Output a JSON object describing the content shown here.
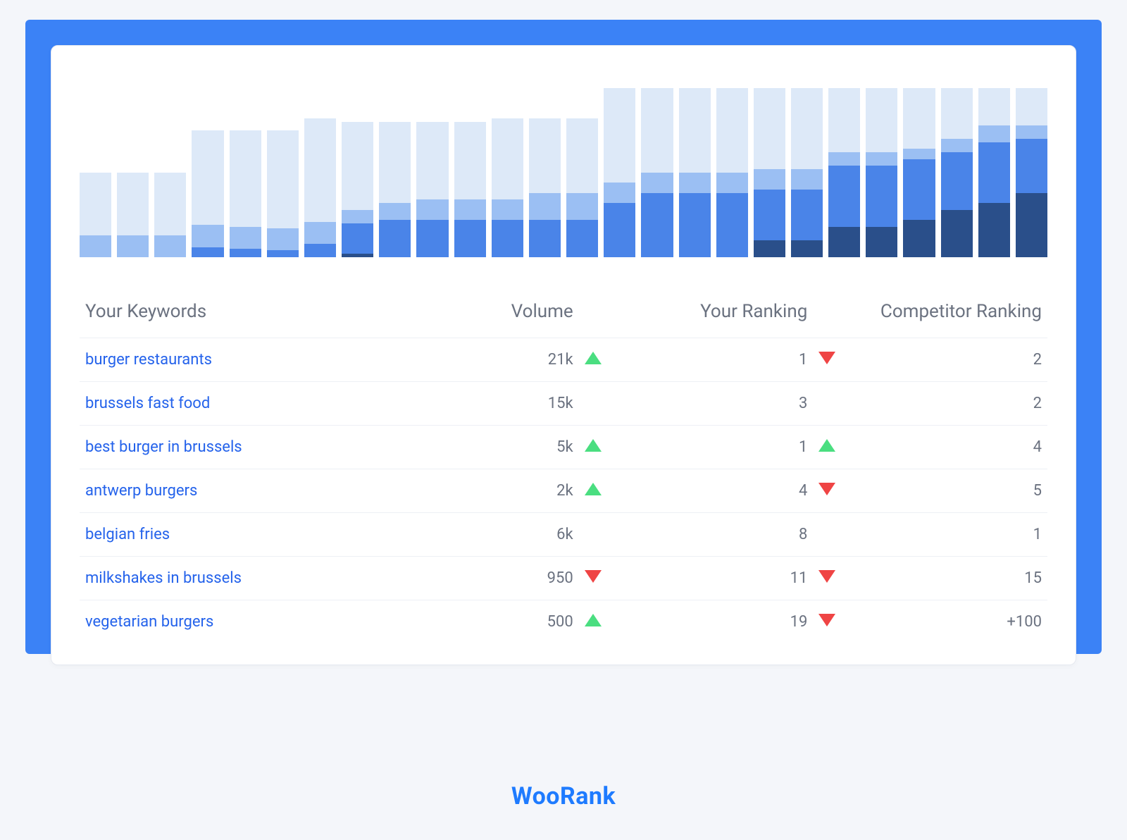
{
  "brand": "WooRank",
  "colors": {
    "frame": "#3b82f6",
    "link": "#2563eb",
    "up": "#4ade80",
    "down": "#ef4444",
    "seg_a": "#dde9f8",
    "seg_b": "#9bbff3",
    "seg_c": "#4a84e8",
    "seg_d": "#2a4f8a"
  },
  "chart_data": {
    "type": "bar",
    "stacked": true,
    "note": "Values are relative stacked segment heights (0-100) estimated visually; no numeric axis is shown.",
    "segment_order_bottom_to_top": [
      "d",
      "c",
      "b",
      "a"
    ],
    "bars": [
      {
        "d": 0,
        "c": 0,
        "b": 13,
        "a": 50
      },
      {
        "d": 0,
        "c": 0,
        "b": 13,
        "a": 50
      },
      {
        "d": 0,
        "c": 0,
        "b": 13,
        "a": 50
      },
      {
        "d": 0,
        "c": 6,
        "b": 13,
        "a": 75
      },
      {
        "d": 0,
        "c": 5,
        "b": 13,
        "a": 75
      },
      {
        "d": 0,
        "c": 4,
        "b": 13,
        "a": 75
      },
      {
        "d": 0,
        "c": 8,
        "b": 13,
        "a": 82
      },
      {
        "d": 2,
        "c": 18,
        "b": 8,
        "a": 80
      },
      {
        "d": 0,
        "c": 22,
        "b": 10,
        "a": 80
      },
      {
        "d": 0,
        "c": 22,
        "b": 12,
        "a": 80
      },
      {
        "d": 0,
        "c": 22,
        "b": 12,
        "a": 80
      },
      {
        "d": 0,
        "c": 22,
        "b": 12,
        "a": 82
      },
      {
        "d": 0,
        "c": 22,
        "b": 16,
        "a": 82
      },
      {
        "d": 0,
        "c": 22,
        "b": 16,
        "a": 82
      },
      {
        "d": 0,
        "c": 32,
        "b": 12,
        "a": 100
      },
      {
        "d": 0,
        "c": 38,
        "b": 12,
        "a": 100
      },
      {
        "d": 0,
        "c": 38,
        "b": 12,
        "a": 100
      },
      {
        "d": 0,
        "c": 38,
        "b": 12,
        "a": 100
      },
      {
        "d": 10,
        "c": 30,
        "b": 12,
        "a": 100
      },
      {
        "d": 10,
        "c": 30,
        "b": 12,
        "a": 100
      },
      {
        "d": 18,
        "c": 36,
        "b": 8,
        "a": 100
      },
      {
        "d": 18,
        "c": 36,
        "b": 8,
        "a": 100
      },
      {
        "d": 22,
        "c": 36,
        "b": 6,
        "a": 100
      },
      {
        "d": 28,
        "c": 34,
        "b": 8,
        "a": 100
      },
      {
        "d": 32,
        "c": 36,
        "b": 10,
        "a": 100
      },
      {
        "d": 38,
        "c": 32,
        "b": 8,
        "a": 100
      }
    ]
  },
  "table": {
    "headers": {
      "keywords": "Your Keywords",
      "volume": "Volume",
      "your_ranking": "Your Ranking",
      "competitor_ranking": "Competitor Ranking"
    },
    "rows": [
      {
        "keyword": "burger restaurants",
        "volume": "21k",
        "your_trend": "up",
        "your_rank": "1",
        "comp_trend": "down",
        "comp_rank": "2"
      },
      {
        "keyword": "brussels fast food",
        "volume": "15k",
        "your_trend": "",
        "your_rank": "3",
        "comp_trend": "",
        "comp_rank": "2"
      },
      {
        "keyword": "best burger in brussels",
        "volume": "5k",
        "your_trend": "up",
        "your_rank": "1",
        "comp_trend": "up",
        "comp_rank": "4"
      },
      {
        "keyword": "antwerp burgers",
        "volume": "2k",
        "your_trend": "up",
        "your_rank": "4",
        "comp_trend": "down",
        "comp_rank": "5"
      },
      {
        "keyword": "belgian fries",
        "volume": "6k",
        "your_trend": "",
        "your_rank": "8",
        "comp_trend": "",
        "comp_rank": "1"
      },
      {
        "keyword": "milkshakes in brussels",
        "volume": "950",
        "your_trend": "down",
        "your_rank": "11",
        "comp_trend": "down",
        "comp_rank": "15"
      },
      {
        "keyword": "vegetarian burgers",
        "volume": "500",
        "your_trend": "up",
        "your_rank": "19",
        "comp_trend": "down",
        "comp_rank": "+100"
      }
    ]
  }
}
